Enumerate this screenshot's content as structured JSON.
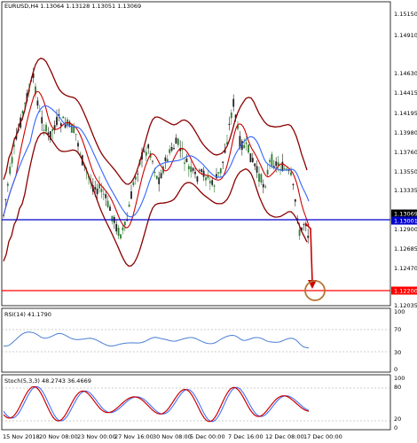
{
  "main_chart": {
    "header": "EURUSD,H4  1.13064 1.13128 1.13051 1.13069",
    "price_labels": [
      "1.15150",
      "1.14910",
      "1.14630",
      "1.14415",
      "1.14195",
      "1.13980",
      "1.13760",
      "1.13550",
      "1.13335",
      "1.13069",
      "1.13001",
      "1.12900",
      "1.12685",
      "1.12470",
      "1.12200",
      "1.12035"
    ],
    "current_price": "1.13069",
    "support_price": "1.13001",
    "target_price": "1.12200",
    "colors": {
      "bollinger": "#8b0000",
      "ma_red": "#cc0000",
      "ma_blue": "#3366ff",
      "support_line": "#0000cc",
      "target_line": "#ff0000",
      "arrow": "#cc0000",
      "circle": "#b87333",
      "current_label_bg": "#000000",
      "support_label_bg": "#0000cc",
      "target_label_bg": "#ff0000"
    }
  },
  "rsi": {
    "header": "RSI(14) 41.1790",
    "levels": [
      "100",
      "70",
      "30",
      "0"
    ],
    "color": "#4a7fd4"
  },
  "stoch": {
    "header": "Stoch(5,3,3) 48.2743 36.4669",
    "levels": [
      "100",
      "80",
      "20",
      "0"
    ],
    "main_color": "#cc0000",
    "signal_color": "#3366ff"
  },
  "time_labels": [
    "15 Nov 2018",
    "20 Nov 08:00",
    "23 Nov 00:00",
    "27 Nov 16:00",
    "30 Nov 08:00",
    "5 Dec 00:00",
    "7 Dec 16:00",
    "12 Dec 08:00",
    "17 Dec 00:00"
  ]
}
